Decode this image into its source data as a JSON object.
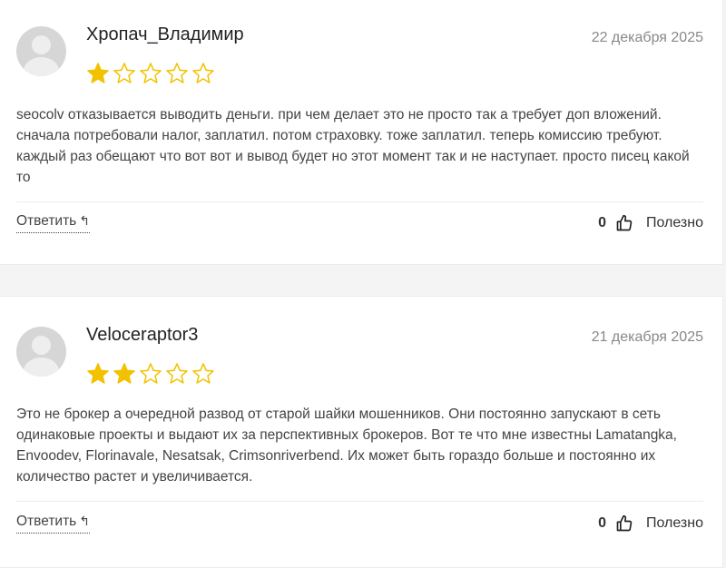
{
  "reviews": [
    {
      "author": "Хропач_Владимир",
      "date": "22 декабря 2025",
      "rating": 1,
      "max_rating": 5,
      "text": "seocolv отказывается выводить деньги. при чем делает это не просто так а требует доп вложений. сначала потребовали налог, заплатил. потом страховку. тоже заплатил. теперь комиссию требуют. каждый раз обещают что вот вот и вывод будет но этот момент так и не наступает. просто писец какой то",
      "reply_label": "Ответить",
      "likes": "0",
      "useful_label": "Полезно"
    },
    {
      "author": "Veloceraptor3",
      "date": "21 декабря 2025",
      "rating": 2,
      "max_rating": 5,
      "text": "Это не брокер а очередной развод от старой шайки мошенников. Они постоянно запускают в сеть одинаковые проекты и выдают их за перспективных брокеров. Вот те что мне известны Lamatangka, Envoodev, Florinavale, Nesatsak, Crimsonriverbend. Их может быть гораздо больше и постоянно их количество растет и увеличивается.",
      "reply_label": "Ответить",
      "likes": "0",
      "useful_label": "Полезно"
    }
  ],
  "colors": {
    "star_filled": "#f2c200",
    "star_empty": "#f2c200",
    "text": "#444444",
    "date": "#888888"
  },
  "icons": {
    "star": "star-icon",
    "thumb": "thumbs-up-icon",
    "reply": "reply-arrow-icon",
    "avatar": "user-avatar-icon"
  }
}
